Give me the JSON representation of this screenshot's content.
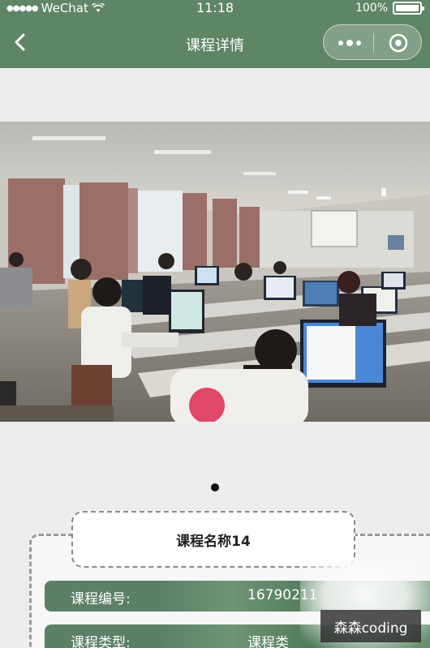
{
  "status_bar": {
    "carrier": "WeChat",
    "time": "11:18",
    "battery_text": "100%",
    "battery_level": 1.0,
    "icons": [
      "signal-dots-icon",
      "wifi-icon",
      "battery-icon"
    ]
  },
  "navbar": {
    "title": "课程详情",
    "back_icon": "chevron-left-icon",
    "more_icon": "more-dots-icon",
    "close_icon": "target-close-icon"
  },
  "banner": {
    "indicator_count": 1,
    "active_index": 0
  },
  "course": {
    "name": "课程名称14",
    "fields": [
      {
        "label": "课程编号:",
        "value": "16790211"
      },
      {
        "label": "课程类型:",
        "value": "课程类"
      }
    ]
  },
  "watermark": "森森coding",
  "colors": {
    "theme_green": "#5f8567",
    "background": "#efeced",
    "card_border": "#8a8a8a"
  }
}
